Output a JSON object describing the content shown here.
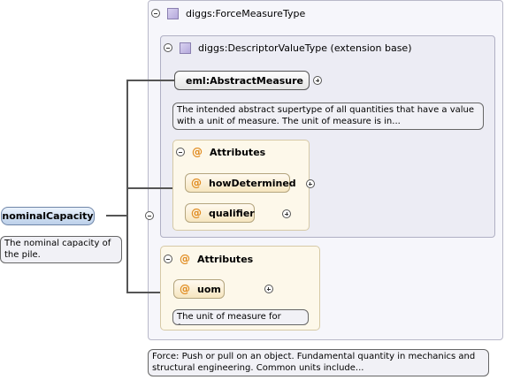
{
  "root": {
    "label": "nominalCapacity",
    "doc": "The nominal capacity of the pile."
  },
  "force_type": {
    "label": "diggs:ForceMeasureType",
    "doc": "Force: Push or pull on an object. Fundamental quantity in mechanics and structural engineering. Common units include..."
  },
  "descriptor": {
    "label": "diggs:DescriptorValueType (extension base)",
    "element": "eml:AbstractMeasure",
    "element_doc": "The intended abstract supertype of all quantities that have a value with a unit of measure. The unit of measure is in...",
    "attributes_label": "Attributes",
    "attributes": [
      {
        "name": "howDetermined"
      },
      {
        "name": "qualifier"
      }
    ]
  },
  "attributes2": {
    "label": "Attributes",
    "uom": "uom",
    "uom_doc": "The unit of measure for force."
  },
  "icons": {
    "at_symbol": "@"
  }
}
